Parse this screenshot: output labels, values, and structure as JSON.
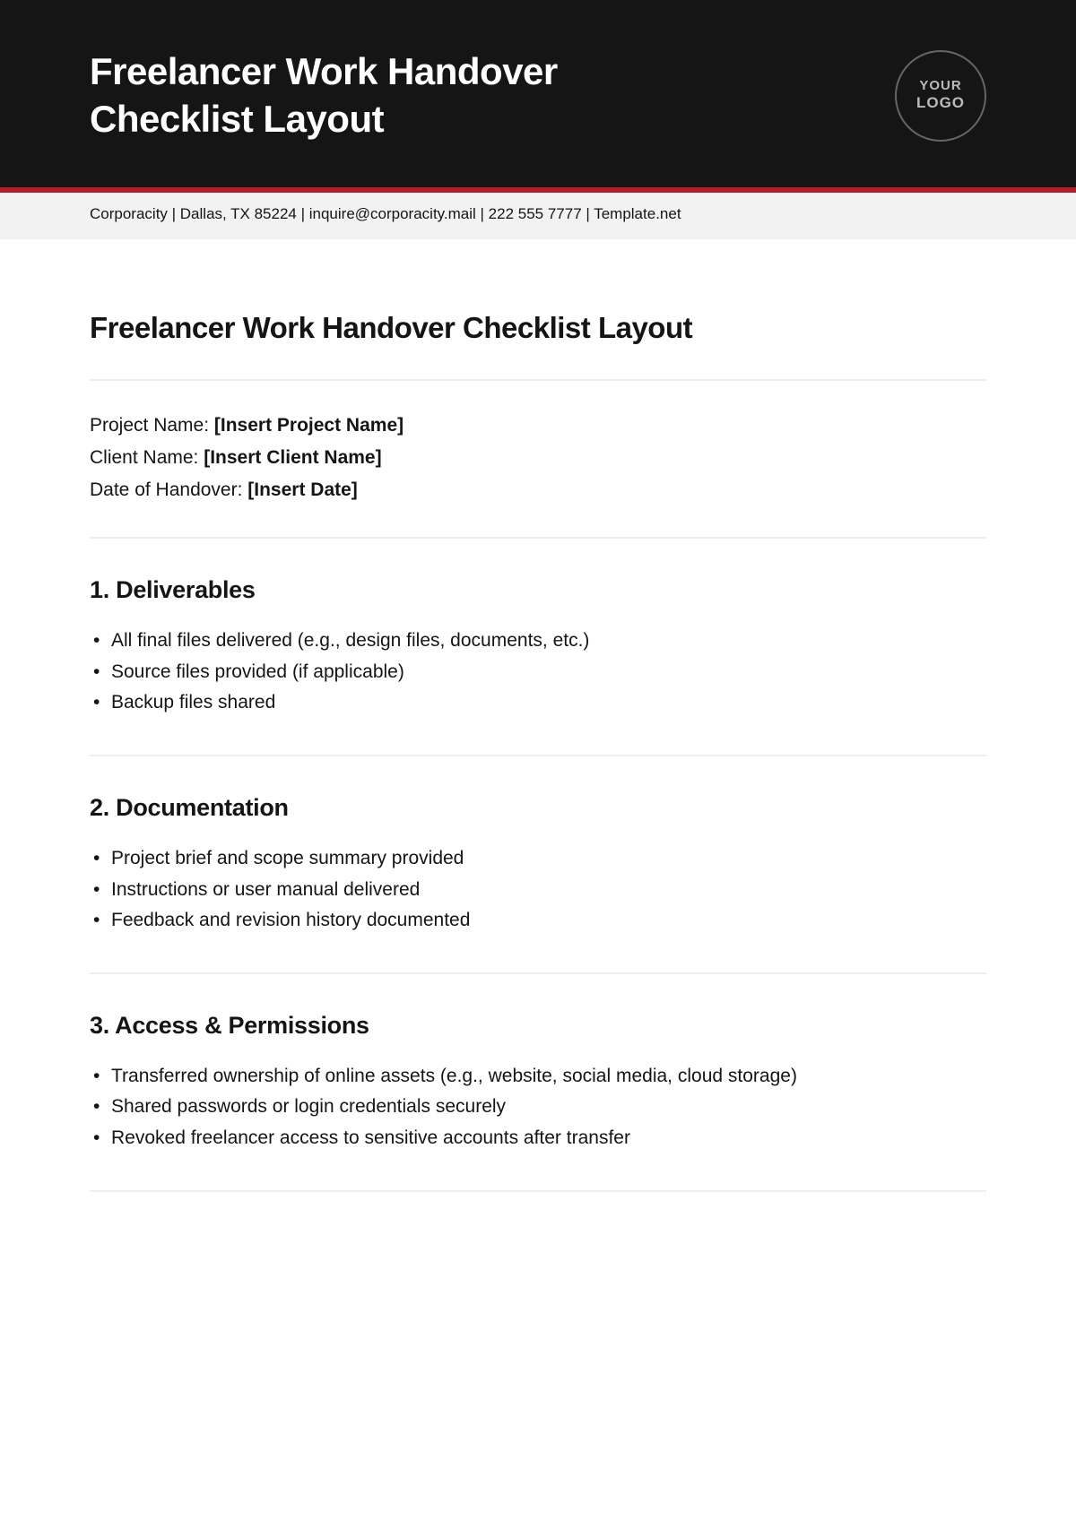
{
  "header": {
    "title": "Freelancer Work Handover Checklist Layout",
    "logo": {
      "line1": "YOUR",
      "line2": "LOGO"
    }
  },
  "infoBar": "Corporacity | Dallas, TX 85224 | inquire@corporacity.mail | 222 555 7777 | Template.net",
  "doc": {
    "title": "Freelancer Work Handover Checklist Layout",
    "meta": [
      {
        "label": "Project Name: ",
        "value": "[Insert Project Name]"
      },
      {
        "label": "Client Name: ",
        "value": "[Insert Client Name]"
      },
      {
        "label": "Date of Handover: ",
        "value": "[Insert Date]"
      }
    ],
    "sections": [
      {
        "heading": "1. Deliverables",
        "items": [
          "All final files delivered (e.g., design files, documents, etc.)",
          "Source files provided (if applicable)",
          "Backup files shared"
        ]
      },
      {
        "heading": "2. Documentation",
        "items": [
          "Project brief and scope summary provided",
          "Instructions or user manual delivered",
          "Feedback and revision history documented"
        ]
      },
      {
        "heading": "3. Access & Permissions",
        "items": [
          "Transferred ownership of online assets (e.g., website, social media, cloud storage)",
          "Shared passwords or login credentials securely",
          "Revoked freelancer access to sensitive accounts after transfer"
        ]
      }
    ]
  }
}
